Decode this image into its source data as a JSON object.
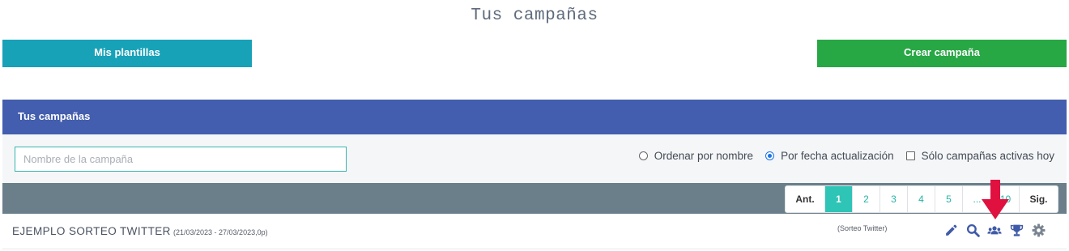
{
  "page": {
    "title": "Tus campañas"
  },
  "buttons": {
    "templates_label": "Mis plantillas",
    "create_label": "Crear campaña"
  },
  "panel": {
    "header": "Tus campañas"
  },
  "filters": {
    "search_placeholder": "Nombre de la campaña",
    "sort_by_name": "Ordenar por nombre",
    "sort_by_date": "Por fecha actualización",
    "sort_selected": "Por fecha actualización",
    "only_active": "Sólo campañas activas hoy",
    "only_active_checked": false
  },
  "pagination": {
    "prev": "Ant.",
    "pages": [
      "1",
      "2",
      "3",
      "4",
      "5",
      "...",
      "10"
    ],
    "current": "1",
    "next": "Sig."
  },
  "campaigns": [
    {
      "name": "EJEMPLO SORTEO TWITTER",
      "dates": "(21/03/2023 - 27/03/2023,0p)",
      "type": "(Sorteo Twitter)",
      "actions": [
        "pencil-icon",
        "magnifier-icon",
        "users-icon",
        "trophy-icon",
        "gear-icon"
      ]
    }
  ],
  "colors": {
    "templates_button": "#17a2b8",
    "create_button": "#28a745",
    "panel_header": "#435eae",
    "pager_bar": "#6b7f8b",
    "active_page": "#2ec4b6",
    "action_icons": "#3f5aa8",
    "highlight_arrow": "#e0103f"
  }
}
